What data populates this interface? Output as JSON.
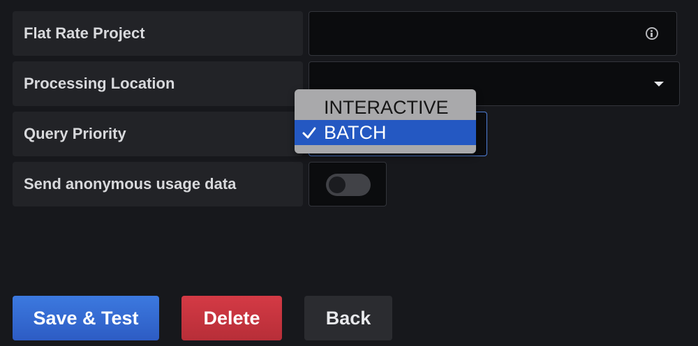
{
  "form": {
    "rows": [
      {
        "label": "Flat Rate Project",
        "value": ""
      },
      {
        "label": "Processing Location",
        "value": ""
      },
      {
        "label": "Query Priority",
        "value": "BATCH"
      },
      {
        "label": "Send anonymous usage data",
        "value": "off"
      }
    ]
  },
  "dropdown": {
    "options": [
      {
        "label": "INTERACTIVE",
        "selected": false
      },
      {
        "label": "BATCH",
        "selected": true
      }
    ]
  },
  "buttons": {
    "save_label": "Save & Test",
    "delete_label": "Delete",
    "back_label": "Back"
  },
  "colors": {
    "background": "#17181c",
    "save": "#3c79df",
    "delete": "#d43a45",
    "back": "#2b2c30",
    "focus_border": "#4f7fd8",
    "dropdown_selected": "#2458c2"
  },
  "icons": {
    "flat_rate_info": "info-icon",
    "processing_location_caret": "caret-down-icon",
    "selected_option_check": "check-icon"
  }
}
